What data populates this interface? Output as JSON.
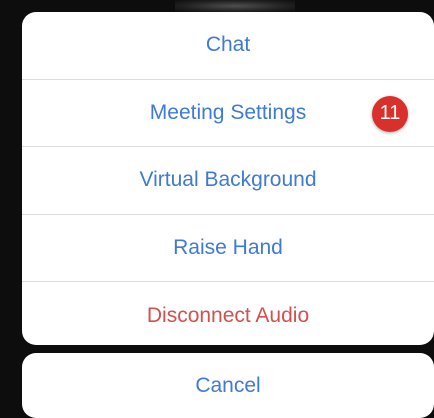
{
  "action_sheet": {
    "items": [
      {
        "label": "Chat",
        "color": "#3f7ad6"
      },
      {
        "label": "Meeting Settings",
        "color": "#3f7ad6"
      },
      {
        "label": "Virtual Background",
        "color": "#3f7ad6"
      },
      {
        "label": "Raise Hand",
        "color": "#3f7ad6"
      },
      {
        "label": "Disconnect Audio",
        "color": "#d2514d"
      }
    ],
    "cancel_label": "Cancel"
  },
  "annotation": {
    "step_number": "11",
    "color": "#d9302b"
  }
}
